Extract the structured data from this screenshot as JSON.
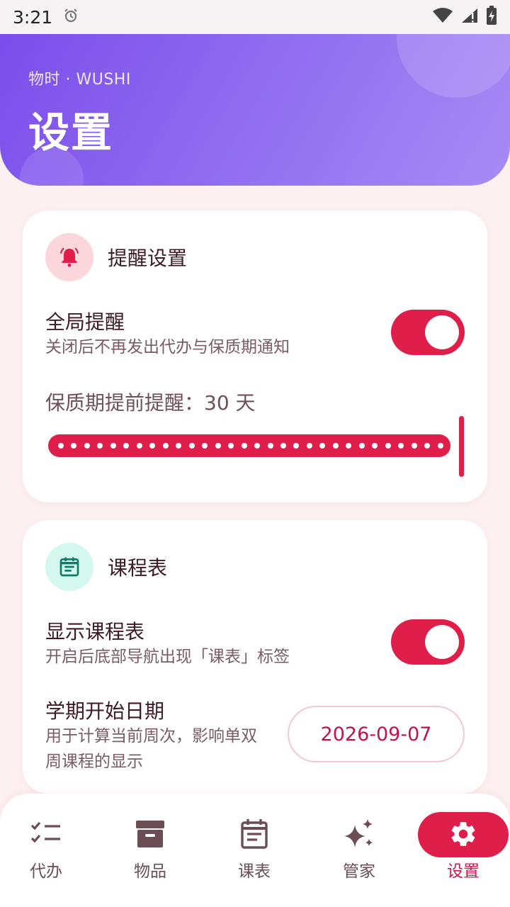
{
  "status_bar": {
    "time": "3:21"
  },
  "header": {
    "brand": "物时 · WUSHI",
    "title": "设置"
  },
  "reminder_card": {
    "title": "提醒设置",
    "global": {
      "title": "全局提醒",
      "subtitle": "关闭后不再发出代办与保质期通知",
      "enabled": true
    },
    "shelf_life": {
      "label": "保质期提前提醒：30 天",
      "days": 30,
      "max_days": 30
    }
  },
  "schedule_card": {
    "title": "课程表",
    "show": {
      "title": "显示课程表",
      "subtitle": "开启后底部导航出现「课表」标签",
      "enabled": true
    },
    "term_start": {
      "title": "学期开始日期",
      "subtitle_line1": "用于计算当前周次，影响单双",
      "subtitle_line2": "周课程的显示",
      "date": "2026-09-07"
    }
  },
  "bottom_nav": {
    "items": [
      {
        "label": "代办",
        "icon": "checklist-icon"
      },
      {
        "label": "物品",
        "icon": "archive-box-icon"
      },
      {
        "label": "课表",
        "icon": "calendar-icon"
      },
      {
        "label": "管家",
        "icon": "sparkle-icon"
      },
      {
        "label": "设置",
        "icon": "gear-icon",
        "active": true
      }
    ]
  },
  "colors": {
    "accent": "#E01E4A",
    "header_start": "#7C4DEB",
    "header_end": "#A88BF5",
    "background": "#FDF0F0"
  }
}
